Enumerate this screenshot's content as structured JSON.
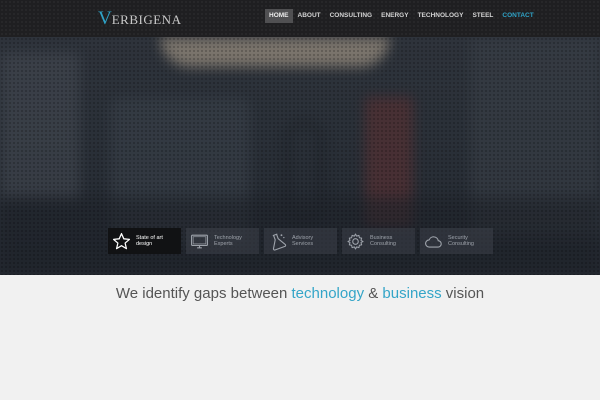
{
  "brand": {
    "logo_initial": "V",
    "logo_rest": "ERBIGENA"
  },
  "nav": {
    "items": [
      "HOME",
      "ABOUT",
      "CONSULTING",
      "ENERGY",
      "TECHNOLOGY",
      "STEEL",
      "CONTACT"
    ],
    "active": "HOME",
    "highlight": "CONTACT"
  },
  "features": [
    {
      "line1": "State of art",
      "line2": "design",
      "icon": "star-icon"
    },
    {
      "line1": "Technology",
      "line2": "Experts",
      "icon": "monitor-icon"
    },
    {
      "line1": "Advisory",
      "line2": "Services",
      "icon": "flask-icon"
    },
    {
      "line1": "Business",
      "line2": "Consulting",
      "icon": "gear-icon"
    },
    {
      "line1": "Security",
      "line2": "Consulting",
      "icon": "cloud-icon"
    }
  ],
  "tagline": {
    "part1": "We identify gaps between ",
    "hl1": "technology",
    "part2": " & ",
    "hl2": "business",
    "part3": " vision"
  },
  "colors": {
    "accent": "#2fa3c7",
    "header_bg": "#1f1f21",
    "page_bg": "#f1f1f1"
  }
}
